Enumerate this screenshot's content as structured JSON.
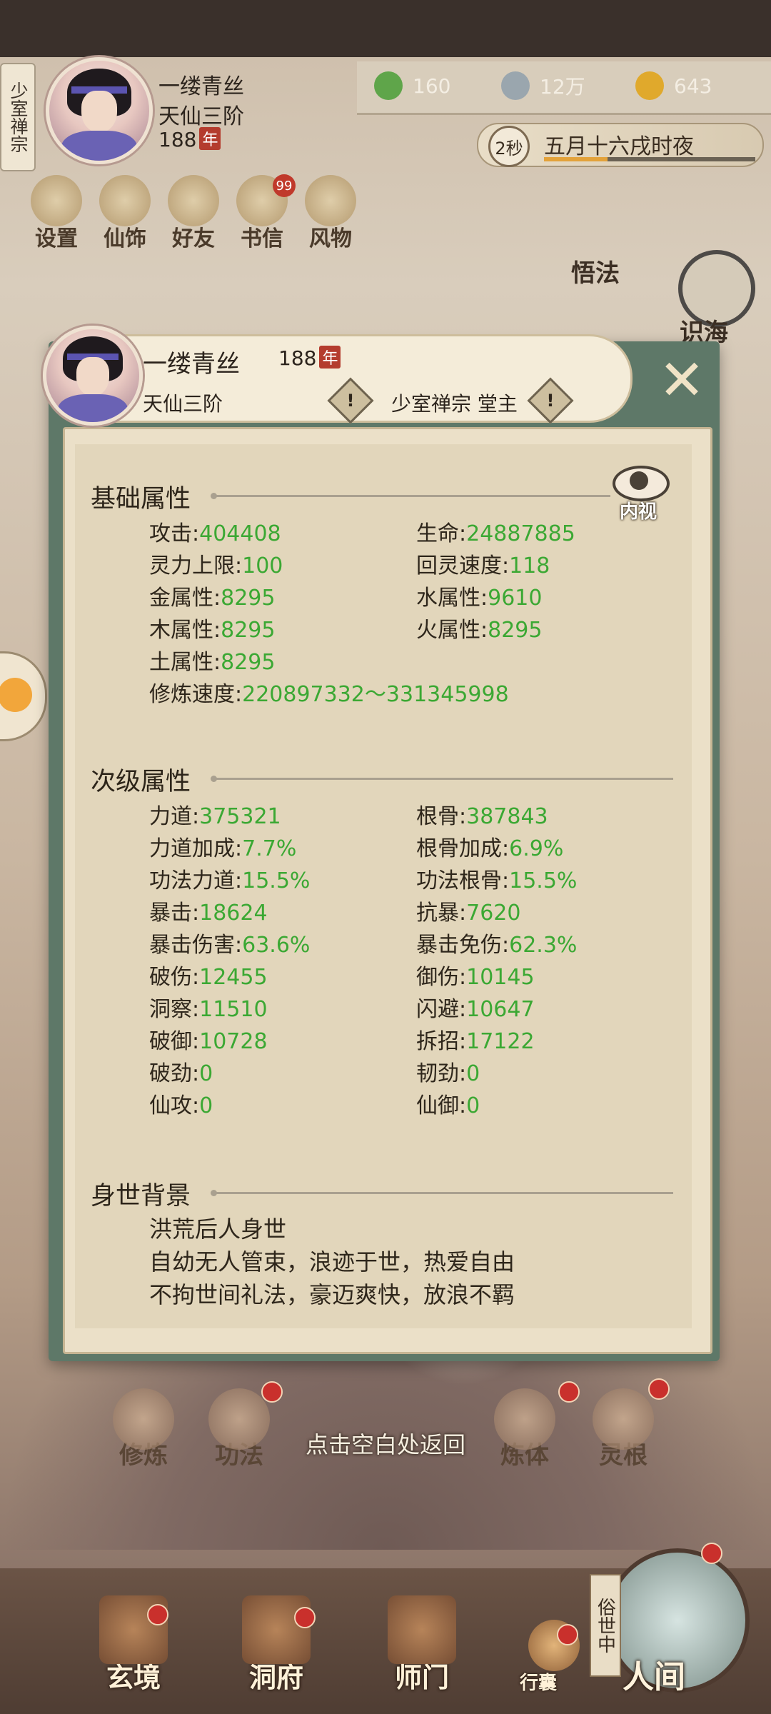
{
  "header": {
    "sect_tag": "少室禅宗",
    "name": "一缕青丝",
    "rank": "天仙三阶",
    "age": "188",
    "age_unit": "年"
  },
  "resources": [
    {
      "icon": "jade-leaf-icon",
      "value": "160"
    },
    {
      "icon": "coin-icon",
      "value": "12万"
    },
    {
      "icon": "gold-ingot-icon",
      "value": "643"
    }
  ],
  "time": {
    "seconds": "2秒",
    "label": "五月十六戌时夜",
    "progress": 0.3
  },
  "quick_menu": [
    "设置",
    "仙饰",
    "好友",
    "书信",
    "风物"
  ],
  "mail_badge": "99",
  "right_menu": {
    "wufa": "悟法",
    "wuhai": "识海"
  },
  "panel": {
    "name": "一缕青丝",
    "age": "188",
    "age_unit": "年",
    "rank": "天仙三阶",
    "sect": "少室禅宗 堂主",
    "warn_symbol": "!",
    "close_symbol": "✕",
    "neishi_label": "内视"
  },
  "basic": {
    "title": "基础属性",
    "stats": [
      {
        "label": "攻击:",
        "value": "404408"
      },
      {
        "label": "生命:",
        "value": "24887885"
      },
      {
        "label": "灵力上限:",
        "value": "100"
      },
      {
        "label": "回灵速度:",
        "value": "118"
      },
      {
        "label": "金属性:",
        "value": "8295"
      },
      {
        "label": "水属性:",
        "value": "9610"
      },
      {
        "label": "木属性:",
        "value": "8295"
      },
      {
        "label": "火属性:",
        "value": "8295"
      },
      {
        "label": "土属性:",
        "value": "8295"
      },
      {
        "label": "修炼速度:",
        "value": "220897332～331345998"
      }
    ]
  },
  "secondary": {
    "title": "次级属性",
    "stats": [
      {
        "label": "力道:",
        "value": "375321"
      },
      {
        "label": "根骨:",
        "value": "387843"
      },
      {
        "label": "力道加成:",
        "value": "7.7%"
      },
      {
        "label": "根骨加成:",
        "value": "6.9%"
      },
      {
        "label": "功法力道:",
        "value": "15.5%"
      },
      {
        "label": "功法根骨:",
        "value": "15.5%"
      },
      {
        "label": "暴击:",
        "value": "18624"
      },
      {
        "label": "抗暴:",
        "value": "7620"
      },
      {
        "label": "暴击伤害:",
        "value": "63.6%"
      },
      {
        "label": "暴击免伤:",
        "value": "62.3%"
      },
      {
        "label": "破伤:",
        "value": "12455"
      },
      {
        "label": "御伤:",
        "value": "10145"
      },
      {
        "label": "洞察:",
        "value": "11510"
      },
      {
        "label": "闪避:",
        "value": "10647"
      },
      {
        "label": "破御:",
        "value": "10728"
      },
      {
        "label": "拆招:",
        "value": "17122"
      },
      {
        "label": "破劲:",
        "value": "0"
      },
      {
        "label": "韧劲:",
        "value": "0"
      },
      {
        "label": "仙攻:",
        "value": "0"
      },
      {
        "label": "仙御:",
        "value": "0"
      }
    ]
  },
  "background": {
    "title": "身世背景",
    "lines": [
      "洪荒后人身世",
      "自幼无人管束，浪迹于世，热爱自由",
      "不拘世间礼法，豪迈爽快，放浪不羁"
    ]
  },
  "return_hint": "点击空白处返回",
  "lower_menu": [
    "修炼",
    "功法",
    "",
    "",
    "炼体",
    "灵根"
  ],
  "nav": [
    "玄境",
    "洞府",
    "师门"
  ],
  "xingnang": "行囊",
  "world_tag": "俗世中",
  "world": "人间",
  "colors": {
    "value_green": "#3ba833",
    "panel_frame": "#5e7868",
    "badge_red": "#c0392b"
  }
}
